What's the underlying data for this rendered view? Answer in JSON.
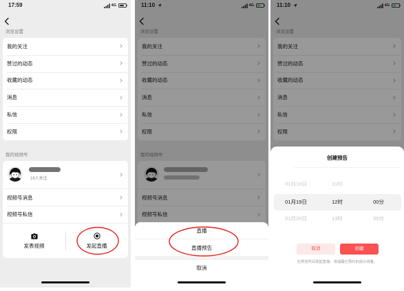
{
  "colors": {
    "accent_red": "#fa5151",
    "annotation_red": "#e3211c",
    "charging_green": "#34c759"
  },
  "icons": {
    "back": "chevron-left-icon",
    "row_arrow": "chevron-right-icon",
    "post_video": "camera-icon",
    "start_live": "live-record-icon",
    "signal": "signal-icon",
    "battery": "battery-icon",
    "location": "location-arrow-icon"
  },
  "browse": {
    "section_title": "浏览设置",
    "items": [
      "我的关注",
      "赞过的动态",
      "收藏的动态",
      "消息",
      "私信",
      "权限"
    ]
  },
  "channel": {
    "section_title": "我的视频号",
    "followers": "16人关注",
    "items": [
      "视频号消息",
      "视频号私信"
    ],
    "actions": {
      "post_video": "发表视频",
      "start_live": "发起直播"
    }
  },
  "screens": [
    {
      "status": {
        "time": "17:59",
        "network": "4G",
        "battery_level": 0.7,
        "charging": false
      }
    },
    {
      "status": {
        "time": "11:10",
        "network": "4G",
        "battery_level": 0.5,
        "charging": true
      },
      "action_sheet": {
        "options": [
          "直播",
          "直播预告"
        ],
        "cancel": "取消"
      }
    },
    {
      "status": {
        "time": "11:10",
        "network": "4G",
        "battery_level": 0.5,
        "charging": true
      },
      "schedule_modal": {
        "title": "创建预告",
        "picker": {
          "rows": [
            {
              "date": "01月18日",
              "hour": "11时"
            },
            {
              "date": "01月19日",
              "hour": "12时",
              "minute": "00分",
              "selected": true
            },
            {
              "date": "01月20日",
              "hour": "13时",
              "minute": "05分"
            }
          ]
        },
        "cancel_label": "取消",
        "create_label": "创建",
        "hint": "在预告时间发起直播，将提醒已预约的观众观看。"
      }
    }
  ]
}
